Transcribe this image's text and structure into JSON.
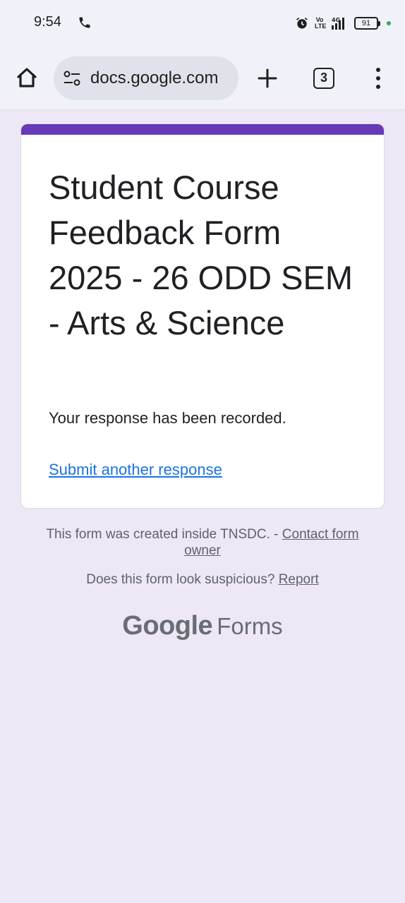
{
  "status_bar": {
    "time": "9:54",
    "volte": "Vo LTE",
    "network": "4G",
    "battery": "91",
    "accent_dot_color": "#34a853"
  },
  "browser": {
    "url": "docs.google.com",
    "tab_count": "3",
    "icons": [
      "home-icon",
      "site-settings-icon",
      "add-icon",
      "tabs-icon",
      "more-vert-icon"
    ]
  },
  "form": {
    "accent_color": "#673ab7",
    "title": "Student Course Feedback Form 2025 - 26 ODD SEM - Arts & Science",
    "confirmation": "Your response has been recorded.",
    "submit_another_label": "Submit another response"
  },
  "footer": {
    "created_text": "This form was created inside TNSDC. - ",
    "contact_owner_label": "Contact form owner",
    "suspicious_text": "Does this form look suspicious? ",
    "report_label": "Report",
    "brand_google": "Google",
    "brand_forms": "Forms"
  }
}
